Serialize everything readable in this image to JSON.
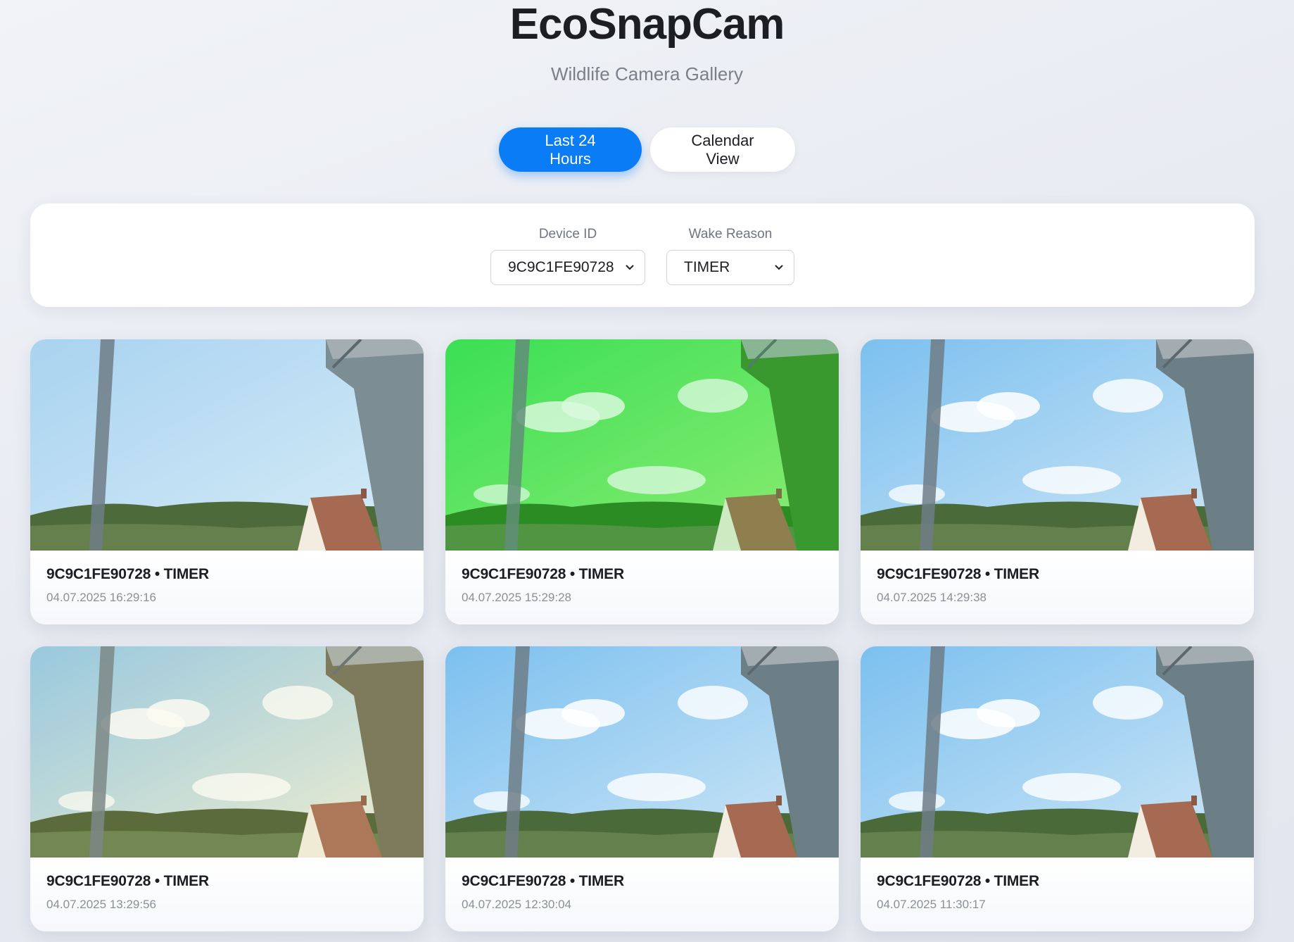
{
  "header": {
    "title": "EcoSnapCam",
    "subtitle": "Wildlife Camera Gallery"
  },
  "view_toggle": {
    "last24_label": "Last 24 Hours",
    "calendar_label": "Calendar View",
    "active": "last24"
  },
  "filters": {
    "device": {
      "label": "Device ID",
      "selected": "9C9C1FE90728"
    },
    "wake_reason": {
      "label": "Wake Reason",
      "selected": "TIMER"
    }
  },
  "colors": {
    "accent": "#0a7cf5",
    "background": "#eceff4"
  },
  "gallery": [
    {
      "title": "9C9C1FE90728 • TIMER",
      "timestamp": "04.07.2025 16:29:16",
      "tint": "blue"
    },
    {
      "title": "9C9C1FE90728 • TIMER",
      "timestamp": "04.07.2025 15:29:28",
      "tint": "green"
    },
    {
      "title": "9C9C1FE90728 • TIMER",
      "timestamp": "04.07.2025 14:29:38",
      "tint": "blue-clouds"
    },
    {
      "title": "9C9C1FE90728 • TIMER",
      "timestamp": "04.07.2025 13:29:56",
      "tint": "warm-clouds"
    },
    {
      "title": "9C9C1FE90728 • TIMER",
      "timestamp": "04.07.2025 12:30:04",
      "tint": "blue-clouds"
    },
    {
      "title": "9C9C1FE90728 • TIMER",
      "timestamp": "04.07.2025 11:30:17",
      "tint": "blue-clouds"
    }
  ]
}
